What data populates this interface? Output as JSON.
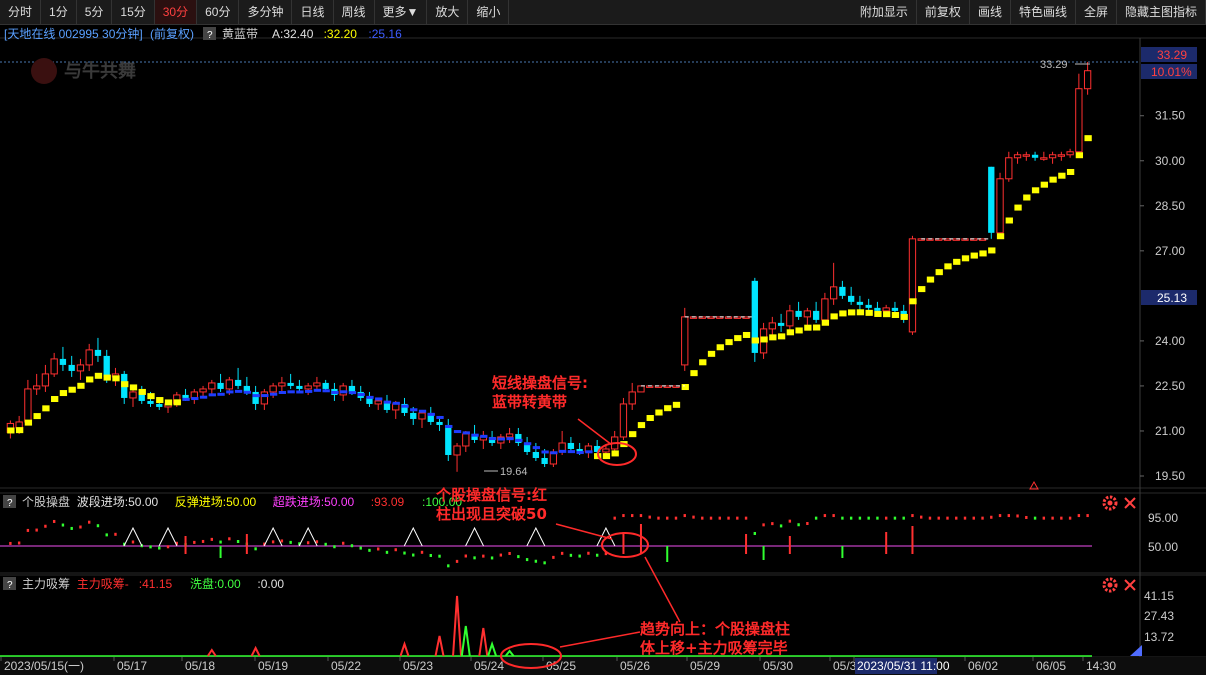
{
  "toolbar": {
    "left": [
      "分时",
      "1分",
      "5分",
      "15分",
      "30分",
      "60分",
      "多分钟",
      "日线",
      "周线",
      "更多▼",
      "放大",
      "缩小"
    ],
    "active": "30分",
    "right": [
      "附加显示",
      "前复权",
      "画线",
      "特色画线",
      "全屏",
      "隐藏主图指标"
    ]
  },
  "main_header": {
    "stock": "[天地在线 002995 30分钟]",
    "adjust": "(前复权)",
    "help": "?",
    "indicator_name": "黄蓝带",
    "values": [
      {
        "text": "A:32.40",
        "color": "#e0e0e0"
      },
      {
        "text": ":32.20",
        "color": "#ffff00"
      },
      {
        "text": ":25.16",
        "color": "#3d5cff"
      }
    ]
  },
  "watermark": "与牛共舞",
  "price_axis": {
    "labels": [
      "33.29",
      "10.01%",
      "31.50",
      "30.00",
      "28.50",
      "27.00",
      "25.13",
      "24.00",
      "22.50",
      "21.00",
      "19.50"
    ],
    "top_tag": "33.29",
    "top_pct": "10.01%",
    "current_tag": "25.13"
  },
  "high_mark": "33.29",
  "low_mark": "19.64",
  "panel1_header": {
    "help": "?",
    "name": "个股操盘",
    "items": [
      {
        "text": "波段进场:50.00",
        "color": "#e0e0e0"
      },
      {
        "text": "反弹进场:50.00",
        "color": "#ffff00"
      },
      {
        "text": "超跌进场:50.00",
        "color": "#ff40ff"
      },
      {
        "text": ":93.09",
        "color": "#ff3030"
      },
      {
        "text": ":100.00",
        "color": "#40ff40"
      }
    ],
    "axis": [
      "95.00",
      "50.00"
    ]
  },
  "panel2_header": {
    "help": "?",
    "name": "主力吸筹",
    "items": [
      {
        "text": "主力吸筹-",
        "color": "#ff3030"
      },
      {
        "text": ":41.15",
        "color": "#ff3030"
      },
      {
        "text": "洗盘:0.00",
        "color": "#40ff40"
      },
      {
        "text": ":0.00",
        "color": "#e0e0e0"
      }
    ],
    "axis": [
      "41.15",
      "27.43",
      "13.72"
    ]
  },
  "date_axis": {
    "labels": [
      "2023/05/15(一)",
      "05/17",
      "05/18",
      "05/19",
      "05/22",
      "05/23",
      "05/24",
      "05/25",
      "05/26",
      "05/29",
      "05/30",
      "05/3",
      "2023/05/31 11:00",
      "06/02",
      "06/05",
      "14:30"
    ],
    "highlight": "2023/05/31 11:00"
  },
  "annotations": {
    "a1": [
      "短线操盘信号:",
      "蓝带转黄带"
    ],
    "a2": [
      "个股操盘信号:红",
      "柱出现且突破50"
    ],
    "a3": [
      "趋势向上：个股操盘柱",
      "体上移+主力吸筹完毕"
    ]
  },
  "chart_data": {
    "type": "candlestick",
    "title": "天地在线 002995 30分钟",
    "ylim": [
      19.2,
      33.6
    ],
    "ohlc": [
      [
        20.95,
        21.35,
        20.75,
        21.25
      ],
      [
        21.1,
        21.5,
        20.9,
        21.3
      ],
      [
        21.3,
        22.7,
        21.2,
        22.4
      ],
      [
        22.4,
        22.9,
        22.2,
        22.5
      ],
      [
        22.5,
        23.2,
        22.3,
        22.9
      ],
      [
        22.9,
        23.6,
        22.8,
        23.4
      ],
      [
        23.4,
        23.8,
        23.0,
        23.2
      ],
      [
        23.2,
        23.5,
        22.8,
        23.0
      ],
      [
        23.0,
        23.4,
        22.7,
        23.2
      ],
      [
        23.2,
        23.9,
        23.0,
        23.7
      ],
      [
        23.7,
        24.1,
        23.3,
        23.5
      ],
      [
        23.5,
        23.7,
        22.6,
        22.8
      ],
      [
        22.8,
        23.1,
        22.5,
        22.9
      ],
      [
        22.9,
        23.0,
        21.9,
        22.1
      ],
      [
        22.1,
        22.4,
        21.8,
        22.3
      ],
      [
        22.3,
        22.5,
        21.9,
        22.0
      ],
      [
        22.0,
        22.3,
        21.8,
        21.9
      ],
      [
        21.9,
        22.1,
        21.7,
        21.8
      ],
      [
        21.8,
        22.0,
        21.6,
        21.9
      ],
      [
        21.9,
        22.3,
        21.8,
        22.2
      ],
      [
        22.2,
        22.4,
        22.0,
        22.1
      ],
      [
        22.1,
        22.4,
        21.9,
        22.3
      ],
      [
        22.3,
        22.5,
        22.1,
        22.4
      ],
      [
        22.4,
        22.7,
        22.2,
        22.6
      ],
      [
        22.6,
        22.9,
        22.3,
        22.4
      ],
      [
        22.4,
        22.8,
        22.2,
        22.7
      ],
      [
        22.7,
        23.1,
        22.4,
        22.5
      ],
      [
        22.5,
        22.8,
        22.2,
        22.3
      ],
      [
        22.3,
        22.5,
        21.7,
        21.9
      ],
      [
        21.9,
        22.4,
        21.7,
        22.3
      ],
      [
        22.3,
        22.6,
        22.1,
        22.5
      ],
      [
        22.5,
        22.8,
        22.3,
        22.6
      ],
      [
        22.6,
        22.9,
        22.4,
        22.5
      ],
      [
        22.5,
        22.7,
        22.3,
        22.4
      ],
      [
        22.4,
        22.6,
        22.2,
        22.5
      ],
      [
        22.5,
        22.8,
        22.4,
        22.6
      ],
      [
        22.6,
        22.7,
        22.3,
        22.4
      ],
      [
        22.4,
        22.6,
        22.0,
        22.2
      ],
      [
        22.2,
        22.6,
        22.0,
        22.5
      ],
      [
        22.5,
        22.7,
        22.2,
        22.3
      ],
      [
        22.3,
        22.5,
        22.0,
        22.1
      ],
      [
        22.1,
        22.3,
        21.8,
        21.9
      ],
      [
        21.9,
        22.1,
        21.7,
        22.0
      ],
      [
        22.0,
        22.2,
        21.6,
        21.7
      ],
      [
        21.7,
        22.0,
        21.4,
        21.9
      ],
      [
        21.9,
        22.1,
        21.5,
        21.6
      ],
      [
        21.6,
        21.8,
        21.2,
        21.4
      ],
      [
        21.4,
        21.7,
        21.1,
        21.6
      ],
      [
        21.6,
        21.8,
        21.2,
        21.3
      ],
      [
        21.3,
        21.5,
        21.0,
        21.2
      ],
      [
        21.2,
        21.4,
        20.0,
        20.2
      ],
      [
        20.2,
        20.6,
        19.64,
        20.5
      ],
      [
        20.5,
        21.0,
        20.3,
        20.9
      ],
      [
        20.9,
        21.2,
        20.6,
        20.7
      ],
      [
        20.7,
        21.0,
        20.4,
        20.8
      ],
      [
        20.8,
        21.0,
        20.5,
        20.6
      ],
      [
        20.6,
        20.9,
        20.4,
        20.8
      ],
      [
        20.8,
        21.1,
        20.6,
        20.9
      ],
      [
        20.9,
        21.1,
        20.5,
        20.6
      ],
      [
        20.6,
        20.8,
        20.2,
        20.3
      ],
      [
        20.3,
        20.6,
        20.0,
        20.1
      ],
      [
        20.1,
        20.4,
        19.8,
        19.9
      ],
      [
        19.9,
        20.4,
        19.8,
        20.3
      ],
      [
        20.3,
        21.0,
        20.2,
        20.6
      ],
      [
        20.6,
        20.8,
        20.3,
        20.4
      ],
      [
        20.4,
        20.6,
        20.2,
        20.3
      ],
      [
        20.3,
        20.6,
        20.1,
        20.5
      ],
      [
        20.5,
        20.7,
        20.2,
        20.3
      ],
      [
        20.3,
        20.5,
        20.1,
        20.4
      ],
      [
        20.4,
        21.0,
        20.3,
        20.8
      ],
      [
        20.8,
        22.1,
        20.7,
        21.9
      ],
      [
        21.9,
        22.6,
        21.7,
        22.3
      ],
      [
        22.3,
        22.5,
        22.3,
        22.5
      ],
      [
        22.5,
        22.5,
        22.5,
        22.5
      ],
      [
        22.5,
        22.5,
        22.5,
        22.5
      ],
      [
        22.5,
        22.5,
        22.5,
        22.5
      ],
      [
        22.5,
        22.5,
        22.5,
        22.5
      ],
      [
        23.2,
        25.1,
        23.0,
        24.8
      ],
      [
        24.8,
        24.8,
        24.8,
        24.8
      ],
      [
        24.8,
        24.8,
        24.8,
        24.8
      ],
      [
        24.8,
        24.8,
        24.8,
        24.8
      ],
      [
        24.8,
        24.8,
        24.8,
        24.8
      ],
      [
        24.8,
        24.8,
        24.8,
        24.8
      ],
      [
        24.8,
        24.8,
        24.8,
        24.8
      ],
      [
        24.8,
        24.8,
        24.8,
        24.8
      ],
      [
        26.0,
        26.1,
        23.3,
        23.6
      ],
      [
        23.6,
        24.6,
        23.4,
        24.4
      ],
      [
        24.4,
        24.8,
        24.1,
        24.6
      ],
      [
        24.6,
        24.9,
        24.3,
        24.5
      ],
      [
        24.5,
        25.2,
        24.3,
        25.0
      ],
      [
        25.0,
        25.3,
        24.7,
        24.8
      ],
      [
        24.8,
        25.1,
        24.5,
        25.0
      ],
      [
        25.0,
        25.3,
        24.6,
        24.7
      ],
      [
        24.7,
        25.6,
        24.6,
        25.4
      ],
      [
        25.4,
        26.6,
        25.2,
        25.8
      ],
      [
        25.8,
        26.0,
        25.4,
        25.5
      ],
      [
        25.5,
        25.8,
        25.2,
        25.3
      ],
      [
        25.3,
        25.5,
        25.0,
        25.2
      ],
      [
        25.2,
        25.4,
        25.0,
        25.1
      ],
      [
        25.1,
        25.3,
        24.9,
        25.0
      ],
      [
        25.0,
        25.2,
        24.8,
        25.1
      ],
      [
        25.1,
        25.3,
        24.9,
        25.0
      ],
      [
        25.0,
        25.2,
        24.6,
        24.8
      ],
      [
        24.3,
        27.5,
        24.2,
        27.4
      ],
      [
        27.4,
        27.4,
        27.4,
        27.4
      ],
      [
        27.4,
        27.4,
        27.4,
        27.4
      ],
      [
        27.4,
        27.4,
        27.4,
        27.4
      ],
      [
        27.4,
        27.4,
        27.4,
        27.4
      ],
      [
        27.4,
        27.4,
        27.4,
        27.4
      ],
      [
        27.4,
        27.4,
        27.4,
        27.4
      ],
      [
        27.4,
        27.4,
        27.4,
        27.4
      ],
      [
        27.4,
        27.4,
        27.4,
        27.4
      ],
      [
        29.8,
        29.8,
        27.4,
        27.6
      ],
      [
        27.6,
        29.6,
        27.5,
        29.4
      ],
      [
        29.4,
        30.3,
        29.3,
        30.1
      ],
      [
        30.1,
        30.3,
        29.9,
        30.2
      ],
      [
        30.2,
        30.3,
        30.0,
        30.2
      ],
      [
        30.2,
        30.3,
        30.0,
        30.1
      ],
      [
        30.1,
        30.3,
        30.0,
        30.1
      ],
      [
        30.1,
        30.3,
        29.9,
        30.2
      ],
      [
        30.2,
        30.3,
        30.0,
        30.2
      ],
      [
        30.2,
        30.4,
        30.1,
        30.3
      ],
      [
        30.3,
        32.9,
        30.2,
        32.4
      ],
      [
        32.4,
        33.29,
        32.2,
        33.0
      ]
    ]
  }
}
